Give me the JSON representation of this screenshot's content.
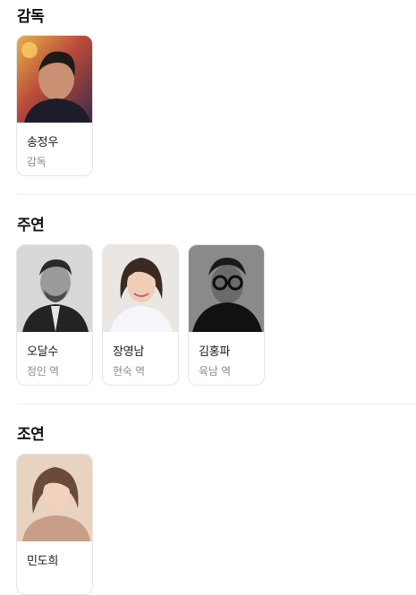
{
  "sections": [
    {
      "title": "감독",
      "people": [
        {
          "name": "송정우",
          "role": "감독",
          "photo_icon": "person-photo-director"
        }
      ]
    },
    {
      "title": "주연",
      "people": [
        {
          "name": "오달수",
          "role": "정인 역",
          "photo_icon": "person-photo-bw-man"
        },
        {
          "name": "장영남",
          "role": "현숙 역",
          "photo_icon": "person-photo-woman"
        },
        {
          "name": "김홍파",
          "role": "육남 역",
          "photo_icon": "person-photo-glasses-man"
        }
      ]
    },
    {
      "title": "조연",
      "people": [
        {
          "name": "민도희",
          "role": "",
          "photo_icon": "person-photo-young-woman"
        }
      ]
    }
  ]
}
